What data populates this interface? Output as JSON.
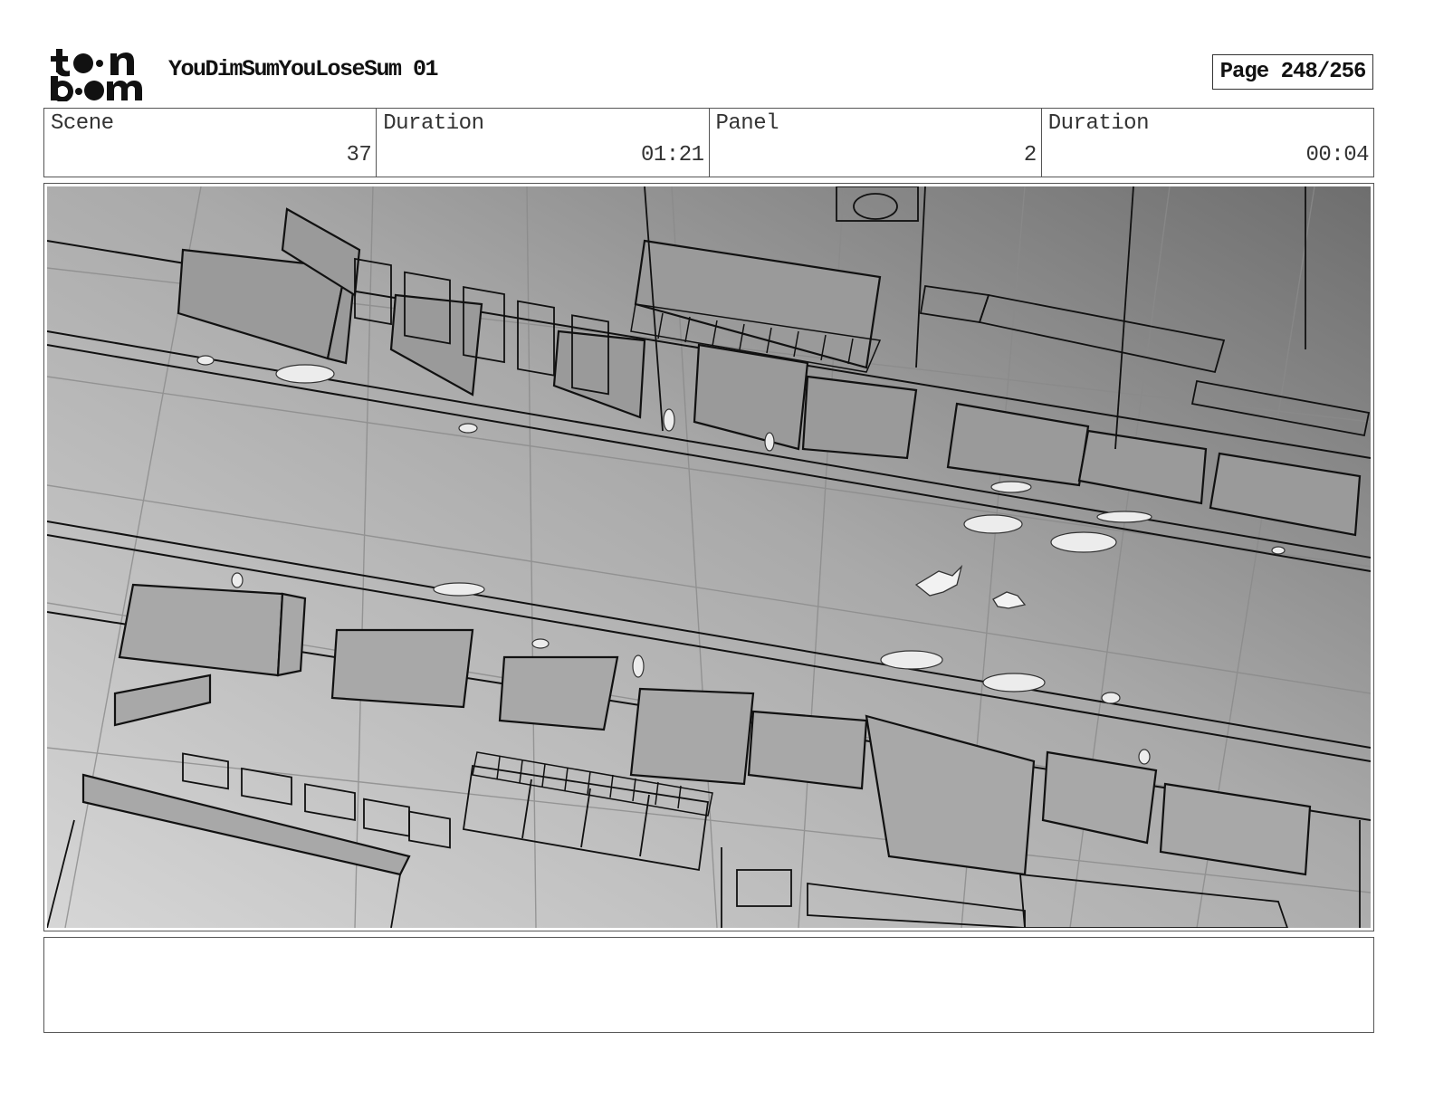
{
  "header": {
    "logo_text": "toon boom",
    "project_title": "YouDimSumYouLoseSum 01",
    "page_label": "Page 248/256"
  },
  "info": {
    "scene_label": "Scene",
    "scene_value": "37",
    "scene_duration_label": "Duration",
    "scene_duration_value": "01:21",
    "panel_label": "Panel",
    "panel_value": "2",
    "panel_duration_label": "Duration",
    "panel_duration_value": "00:04"
  },
  "panel": {
    "image_description_icon": "storyboard-sketch-icon"
  },
  "caption": {
    "text": ""
  }
}
